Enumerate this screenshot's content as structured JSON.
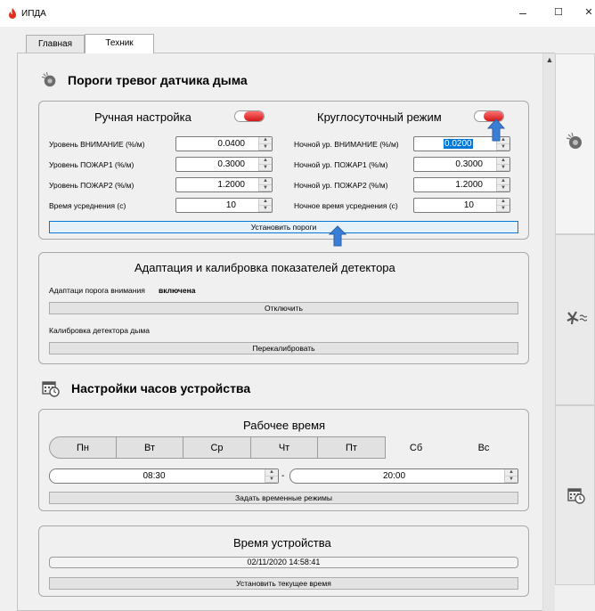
{
  "window": {
    "title": "ИПДА",
    "minimize": "–",
    "maximize": "☐",
    "close": "✕"
  },
  "tabs": [
    {
      "label": "Главная"
    },
    {
      "label": "Техник"
    }
  ],
  "smoke": {
    "title": "Пороги тревог датчика дыма",
    "manual": {
      "title": "Ручная настройка",
      "rows": [
        {
          "label": "Уровень ВНИМАНИЕ (%/м)",
          "value": "0.0400"
        },
        {
          "label": "Уровень ПОЖАР1 (%/м)",
          "value": "0.3000"
        },
        {
          "label": "Уровень ПОЖАР2 (%/м)",
          "value": "1.2000"
        },
        {
          "label": "Время усреднения (с)",
          "value": "10"
        }
      ]
    },
    "night": {
      "title": "Круглосуточный режим",
      "rows": [
        {
          "label": "Ночной ур. ВНИМАНИЕ (%/м)",
          "value": "0.0200"
        },
        {
          "label": "Ночной ур. ПОЖАР1 (%/м)",
          "value": "0.3000"
        },
        {
          "label": "Ночной ур. ПОЖАР2 (%/м)",
          "value": "1.2000"
        },
        {
          "label": "Ночное время усреднения (с)",
          "value": "10"
        }
      ]
    },
    "set_button": "Установить пороги"
  },
  "adapt": {
    "title": "Адаптация и калибровка показателей детектора",
    "status_label": "Адаптаци порога внимания",
    "status_value": "включена",
    "disable_button": "Отключить",
    "calib_label": "Калибровка детектора дыма",
    "recalib_button": "Перекалибровать"
  },
  "clock": {
    "title": "Настройки часов устройства",
    "work_title": "Рабочее время",
    "days": [
      "Пн",
      "Вт",
      "Ср",
      "Чт",
      "Пт",
      "Сб",
      "Вс"
    ],
    "start": "08:30",
    "dash": "-",
    "end": "20:00",
    "set_modes_button": "Задать временные режимы",
    "device_time_title": "Время устройства",
    "device_time": "02/11/2020  14:58:41",
    "set_time_button": "Установить текущее время"
  },
  "scroll_up": "▲",
  "colors": {
    "toggle_on": "#d01818",
    "arrow": "#3a7fd5",
    "focus": "#0078d7"
  },
  "icons": [
    "smoke-detector-icon",
    "calendar-clock-icon",
    "fan-icon"
  ]
}
